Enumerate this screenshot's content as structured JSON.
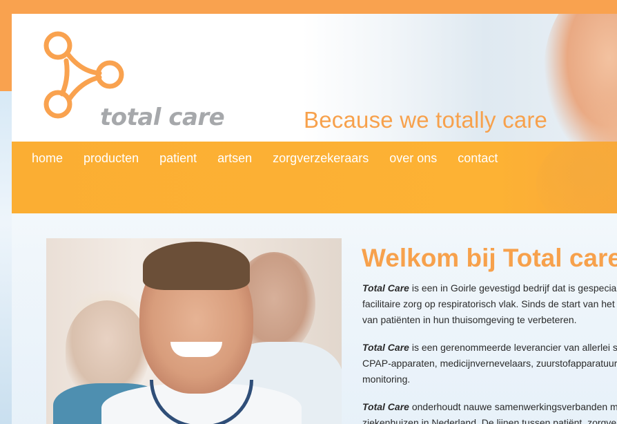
{
  "header": {
    "logo_text": "total care",
    "tagline": "Because we totally care"
  },
  "nav": {
    "items": [
      "home",
      "producten",
      "patient",
      "artsen",
      "zorgverzekeraars",
      "over ons",
      "contact"
    ]
  },
  "main": {
    "title": "Welkom bij Total care",
    "paragraphs": [
      {
        "brand": "Total Care",
        "lines": [
          " is een in Goirle gevestigd bedrijf dat is gespecialiseer",
          "facilitaire zorg op respiratorisch vlak. Sinds de start van het bedr",
          "van patiënten in hun thuisomgeving te verbeteren."
        ]
      },
      {
        "brand": "Total Care",
        "lines": [
          " is een gerenommeerde leverancier van allerlei special",
          "CPAP-apparaten, medicijnvernevelaars, zuurstofapparatuur, MRA-",
          "monitoring."
        ]
      },
      {
        "brand": "Total Care",
        "lines": [
          " onderhoudt nauwe samenwerkingsverbanden met vrij",
          "ziekenhuizen in Nederland. De lijnen tussen patiënt, zorgverzeker"
        ]
      }
    ]
  },
  "colors": {
    "orange": "#f9a24f",
    "nav_orange": "#fdb234",
    "logo_gray": "#a6a8ab"
  }
}
